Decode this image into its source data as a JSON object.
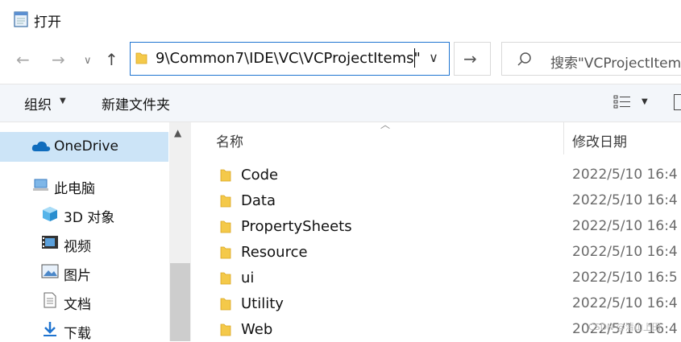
{
  "window": {
    "title": "打开"
  },
  "address": {
    "path": "9\\Common7\\IDE\\VC\\VCProjectItems\""
  },
  "search": {
    "placeholder": "搜索\"VCProjectItem"
  },
  "toolbar": {
    "organize_label": "组织",
    "new_folder_label": "新建文件夹"
  },
  "sidebar": {
    "items": [
      {
        "label": "OneDrive",
        "icon": "cloud-icon",
        "selected": true
      },
      {
        "label": "此电脑",
        "icon": "computer-icon"
      },
      {
        "label": "3D 对象",
        "icon": "cube-icon"
      },
      {
        "label": "视频",
        "icon": "video-icon"
      },
      {
        "label": "图片",
        "icon": "picture-icon"
      },
      {
        "label": "文档",
        "icon": "document-icon"
      },
      {
        "label": "下载",
        "icon": "download-icon"
      }
    ]
  },
  "columns": {
    "name": "名称",
    "date": "修改日期"
  },
  "files": [
    {
      "name": "Code",
      "date": "2022/5/10 16:4"
    },
    {
      "name": "Data",
      "date": "2022/5/10 16:4"
    },
    {
      "name": "PropertySheets",
      "date": "2022/5/10 16:4"
    },
    {
      "name": "Resource",
      "date": "2022/5/10 16:4"
    },
    {
      "name": "ui",
      "date": "2022/5/10 16:5"
    },
    {
      "name": "Utility",
      "date": "2022/5/10 16:4"
    },
    {
      "name": "Web",
      "date": "2022/5/10 16:4"
    }
  ],
  "watermark": "CSDN @清山上田",
  "colors": {
    "accent": "#1f74d0",
    "selection": "#cce4f7",
    "folder": "#f4c94a"
  }
}
